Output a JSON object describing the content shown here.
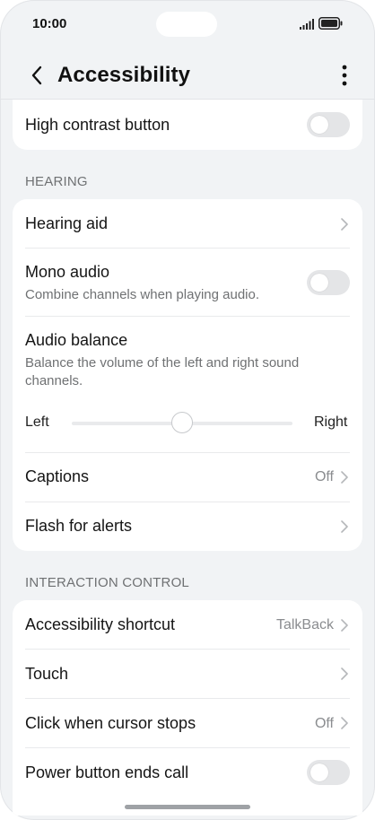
{
  "status": {
    "time": "10:00"
  },
  "header": {
    "title": "Accessibility"
  },
  "sections": {
    "hearing": "HEARING",
    "interaction": "INTERACTION CONTROL"
  },
  "rows": {
    "high_contrast": {
      "label": "High contrast button",
      "enabled": false
    },
    "hearing_aid": {
      "label": "Hearing aid"
    },
    "mono_audio": {
      "label": "Mono audio",
      "subtitle": "Combine channels when playing audio.",
      "enabled": false
    },
    "audio_balance": {
      "label": "Audio balance",
      "subtitle_line1": "Balance the volume of the left and right sound",
      "subtitle_line2": "channels.",
      "left_label": "Left",
      "right_label": "Right",
      "value_fraction": 0.5
    },
    "captions": {
      "label": "Captions",
      "value": "Off"
    },
    "flash_alerts": {
      "label": "Flash for alerts"
    },
    "accessibility_shortcut": {
      "label": "Accessibility shortcut",
      "value": "TalkBack"
    },
    "touch": {
      "label": "Touch"
    },
    "click_cursor": {
      "label": "Click when cursor stops",
      "value": "Off"
    },
    "power_ends_call": {
      "label": "Power button ends call",
      "enabled": false
    }
  },
  "colors": {
    "background": "#f1f3f5",
    "card": "#ffffff",
    "toggle_off": "#e4e5e7"
  }
}
